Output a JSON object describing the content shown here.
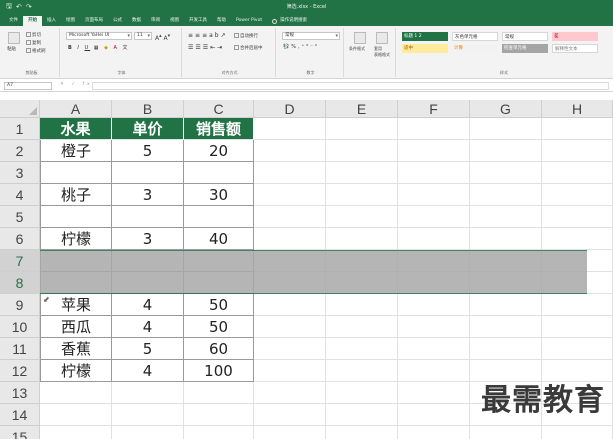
{
  "titlebar": {
    "qat_save": "🖫",
    "qat_undo": "↶",
    "qat_redo": "↷",
    "title": "筛选.xlsx - Excel"
  },
  "tabs": [
    {
      "label": "文件",
      "active": false
    },
    {
      "label": "开始",
      "active": true
    },
    {
      "label": "插入",
      "active": false
    },
    {
      "label": "绘图",
      "active": false
    },
    {
      "label": "页面布局",
      "active": false
    },
    {
      "label": "公式",
      "active": false
    },
    {
      "label": "数据",
      "active": false
    },
    {
      "label": "审阅",
      "active": false
    },
    {
      "label": "视图",
      "active": false
    },
    {
      "label": "开发工具",
      "active": false
    },
    {
      "label": "帮助",
      "active": false
    },
    {
      "label": "Power Pivot",
      "active": false
    }
  ],
  "tell_me": "操作说明搜索",
  "ribbon": {
    "clipboard": {
      "paste": "粘贴",
      "cut": "剪切",
      "copy": "复制",
      "format_painter": "格式刷",
      "label": "剪贴板"
    },
    "font": {
      "name": "Microsoft YaHei UI",
      "size": "11",
      "label": "字体",
      "bold": "B",
      "italic": "I",
      "underline": "U"
    },
    "alignment": {
      "wrap": "自动换行",
      "merge": "合并后居中",
      "label": "对齐方式"
    },
    "number": {
      "format": "常规",
      "label": "数字"
    },
    "styles_group": {
      "conditional": "条件格式",
      "table": "套用\n表格格式",
      "label": "样式"
    },
    "styles": [
      {
        "label": "标题 1 2",
        "bg": "#217346",
        "fg": "#ffffff"
      },
      {
        "label": "灰色单元格",
        "bg": "#ffffff",
        "fg": "#333333"
      },
      {
        "label": "常规",
        "bg": "#ffffff",
        "fg": "#333333"
      },
      {
        "label": "差",
        "bg": "#ffc7ce",
        "fg": "#9c0006"
      },
      {
        "label": "适中",
        "bg": "#ffeb9c",
        "fg": "#9c5700"
      },
      {
        "label": "计算",
        "bg": "#f2f2f2",
        "fg": "#fa7d00"
      },
      {
        "label": "检查单元格",
        "bg": "#a5a5a5",
        "fg": "#ffffff"
      },
      {
        "label": "解释性文本",
        "bg": "#ffffff",
        "fg": "#7f7f7f"
      }
    ]
  },
  "formula_bar": {
    "name_box": "A7",
    "cancel": "✕",
    "enter": "✓",
    "fx": "fx",
    "value": ""
  },
  "columns": [
    "A",
    "B",
    "C",
    "D",
    "E",
    "F",
    "G",
    "H"
  ],
  "rows": [
    {
      "n": "1",
      "a": "水果",
      "b": "单价",
      "c": "销售额",
      "header": true
    },
    {
      "n": "2",
      "a": "橙子",
      "b": "5",
      "c": "20"
    },
    {
      "n": "3",
      "a": "",
      "b": "",
      "c": ""
    },
    {
      "n": "4",
      "a": "桃子",
      "b": "3",
      "c": "30"
    },
    {
      "n": "5",
      "a": "",
      "b": "",
      "c": ""
    },
    {
      "n": "6",
      "a": "柠檬",
      "b": "3",
      "c": "40"
    },
    {
      "n": "7",
      "a": "",
      "b": "",
      "c": "",
      "selected": true
    },
    {
      "n": "8",
      "a": "",
      "b": "",
      "c": "",
      "selected": true
    },
    {
      "n": "9",
      "a": "苹果",
      "b": "4",
      "c": "50"
    },
    {
      "n": "10",
      "a": "西瓜",
      "b": "4",
      "c": "50"
    },
    {
      "n": "11",
      "a": "香蕉",
      "b": "5",
      "c": "60"
    },
    {
      "n": "12",
      "a": "柠檬",
      "b": "4",
      "c": "100"
    },
    {
      "n": "13",
      "a": "",
      "b": "",
      "c": ""
    },
    {
      "n": "14",
      "a": "",
      "b": "",
      "c": ""
    },
    {
      "n": "15",
      "a": "",
      "b": "",
      "c": ""
    }
  ],
  "watermark": "最需教育",
  "colors": {
    "accent": "#217346",
    "selection": "#a9a9a9"
  }
}
